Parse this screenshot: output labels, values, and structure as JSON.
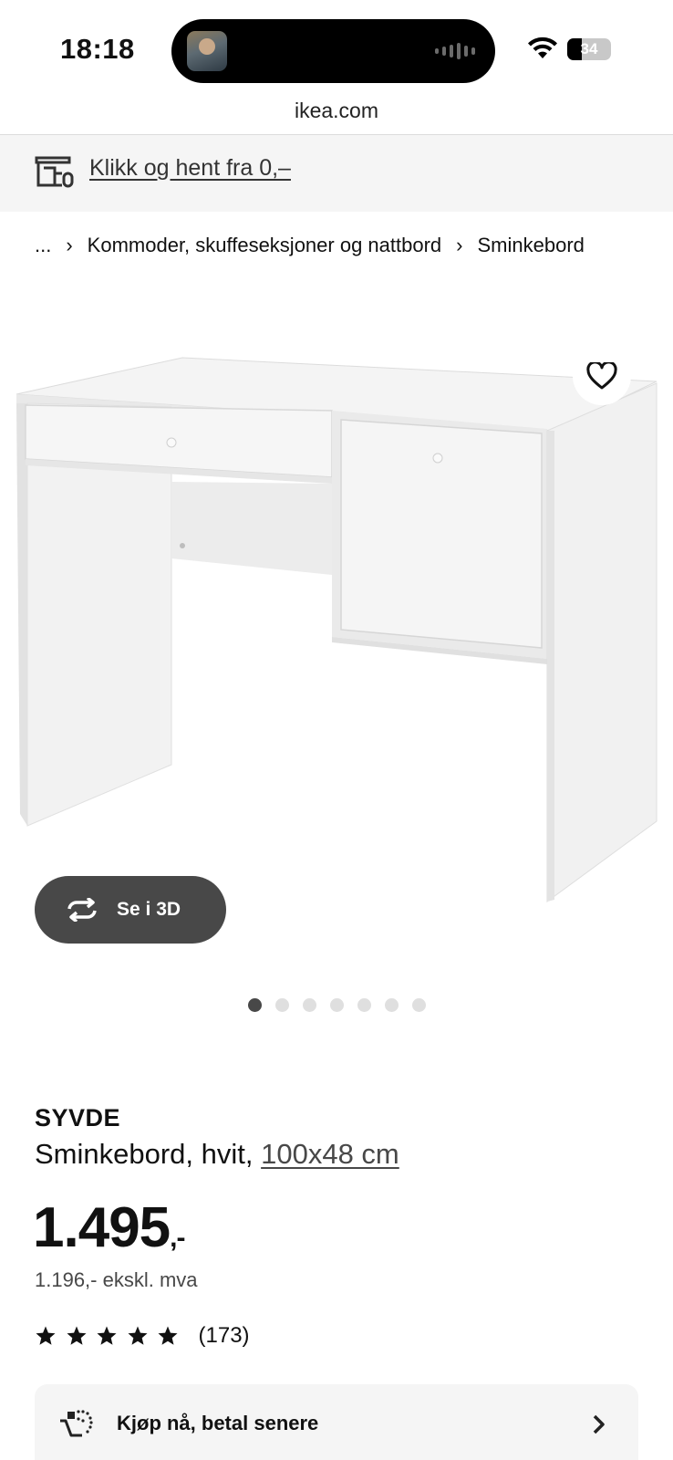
{
  "status_bar": {
    "time": "18:18",
    "battery": "34",
    "battery_level": 0.34
  },
  "browser": {
    "url": "ikea.com"
  },
  "banner": {
    "link_text": "Klikk og hent fra 0,–"
  },
  "breadcrumb": {
    "ellipsis": "...",
    "separator": "›",
    "items": [
      "Kommoder, skuffeseksjoner og nattbord",
      "Sminkebord"
    ]
  },
  "gallery": {
    "view_3d_label": "Se i 3D",
    "image_count": 7,
    "active_index": 0
  },
  "product": {
    "name": "SYVDE",
    "description": "Sminkebord, hvit, ",
    "dimensions": "100x48 cm",
    "price": "1.495",
    "price_suffix": ",-",
    "price_excl_vat": "1.196,- ekskl. mva",
    "rating_stars": 5,
    "review_count": "(173)"
  },
  "bnpl": {
    "label": "Kjøp nå, betal senere"
  },
  "colors": {
    "dark_button": "#484848",
    "banner_bg": "#f5f5f5",
    "text": "#111111"
  },
  "icons": {
    "store": "store-icon",
    "heart": "heart-icon",
    "rotate": "rotate-3d-icon",
    "star": "star-icon",
    "card": "payment-icon",
    "chevron": "chevron-right-icon"
  }
}
